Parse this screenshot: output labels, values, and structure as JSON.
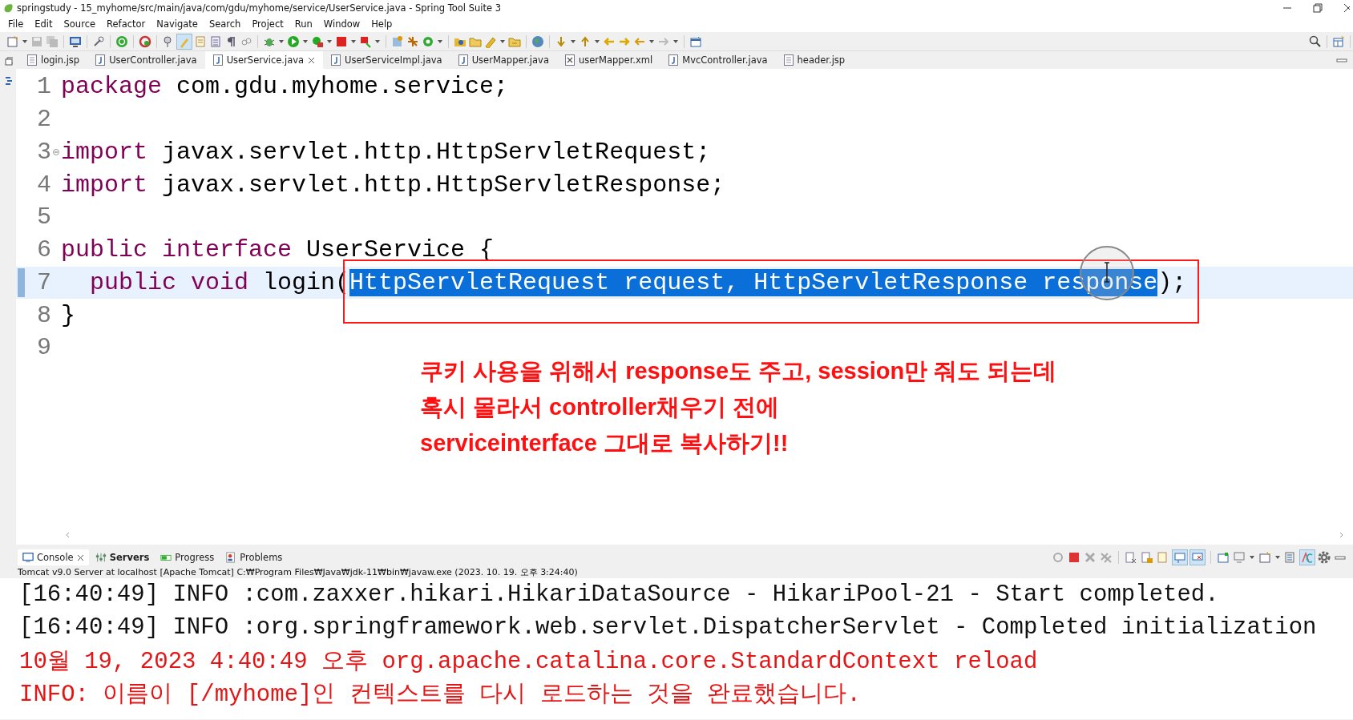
{
  "window": {
    "title": "springstudy - 15_myhome/src/main/java/com/gdu/myhome/service/UserService.java - Spring Tool Suite 3"
  },
  "menu": [
    "File",
    "Edit",
    "Source",
    "Refactor",
    "Navigate",
    "Search",
    "Project",
    "Run",
    "Window",
    "Help"
  ],
  "editor_tabs": [
    {
      "label": "login.jsp",
      "kind": "jsp",
      "selected": false
    },
    {
      "label": "UserController.java",
      "kind": "java",
      "selected": false
    },
    {
      "label": "UserService.java",
      "kind": "java",
      "selected": true
    },
    {
      "label": "UserServiceImpl.java",
      "kind": "java",
      "selected": false
    },
    {
      "label": "UserMapper.java",
      "kind": "java",
      "selected": false
    },
    {
      "label": "userMapper.xml",
      "kind": "xml",
      "selected": false
    },
    {
      "label": "MvcController.java",
      "kind": "java",
      "selected": false
    },
    {
      "label": "header.jsp",
      "kind": "jsp",
      "selected": false
    }
  ],
  "editor": {
    "lines": [
      {
        "number": "1",
        "current": false,
        "foldable": false,
        "tokens": [
          {
            "kind": "keyword",
            "text": "package"
          },
          {
            "kind": "plain",
            "text": " com.gdu.myhome.service;"
          }
        ]
      },
      {
        "number": "2",
        "current": false,
        "foldable": false
      },
      {
        "number": "3",
        "current": false,
        "foldable": true,
        "tokens": [
          {
            "kind": "keyword",
            "text": "import"
          },
          {
            "kind": "plain",
            "text": " javax.servlet.http.HttpServletRequest;"
          }
        ]
      },
      {
        "number": "4",
        "current": false,
        "foldable": false,
        "tokens": [
          {
            "kind": "keyword",
            "text": "import"
          },
          {
            "kind": "plain",
            "text": " javax.servlet.http.HttpServletResponse;"
          }
        ]
      },
      {
        "number": "5",
        "current": false,
        "foldable": false
      },
      {
        "number": "6",
        "current": false,
        "foldable": false,
        "tokens": [
          {
            "kind": "keyword",
            "text": "public "
          },
          {
            "kind": "keyword",
            "text": "interface "
          },
          {
            "kind": "plain",
            "text": "UserService {"
          }
        ]
      },
      {
        "number": "7",
        "current": true,
        "foldable": false,
        "tokens": [
          {
            "kind": "keyword",
            "text": "  public "
          },
          {
            "kind": "keyword",
            "text": "void "
          },
          {
            "kind": "plain",
            "text": "login("
          },
          {
            "kind": "selected",
            "text": "HttpServletRequest request, HttpServletResponse response"
          },
          {
            "kind": "plain",
            "text": ");"
          }
        ]
      },
      {
        "number": "8",
        "current": false,
        "foldable": false,
        "tokens": [
          {
            "kind": "plain",
            "text": "}"
          }
        ]
      },
      {
        "number": "9",
        "current": false,
        "foldable": false
      }
    ],
    "annotation": [
      "쿠키 사용을 위해서 response도 주고, session만 줘도 되는데",
      "혹시 몰라서 controller채우기 전에",
      "serviceinterface 그대로 복사하기!!"
    ]
  },
  "console_tabs": [
    {
      "label": "Console",
      "selected": true,
      "bold": false
    },
    {
      "label": "Servers",
      "selected": false,
      "bold": true
    },
    {
      "label": "Progress",
      "selected": false,
      "bold": false
    },
    {
      "label": "Problems",
      "selected": false,
      "bold": false
    }
  ],
  "console": {
    "description": "Tomcat v9.0 Server at localhost [Apache Tomcat] C:₩Program Files₩Java₩jdk-11₩bin₩javaw.exe  (2023. 10. 19. 오후 3:24:40)",
    "lines": [
      {
        "kind": "info",
        "text": "[16:40:49] INFO :com.zaxxer.hikari.HikariDataSource - HikariPool-21 - Start completed."
      },
      {
        "kind": "info",
        "text": "[16:40:49] INFO :org.springframework.web.servlet.DispatcherServlet - Completed initialization"
      },
      {
        "kind": "error",
        "text": "10월 19, 2023 4:40:49 오후 org.apache.catalina.core.StandardContext reload"
      },
      {
        "kind": "error",
        "text": "INFO: 이름이 [/myhome]인 컨텍스트를 다시 로드하는 것을 완료했습니다."
      }
    ]
  }
}
